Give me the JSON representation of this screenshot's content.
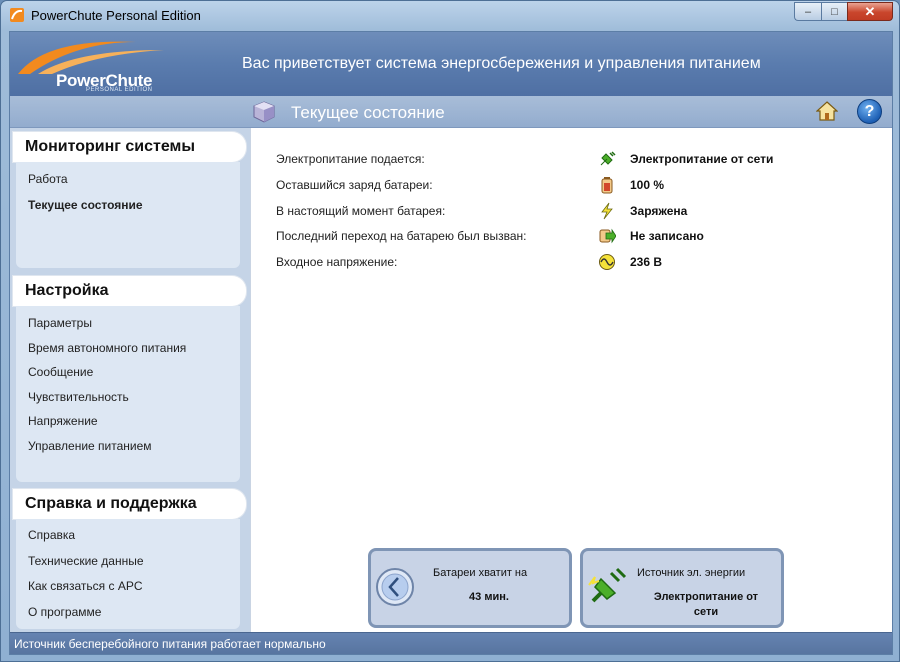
{
  "window": {
    "title": "PowerChute Personal Edition",
    "controls": {
      "minimize": "‒",
      "maximize": "□",
      "close": "✕"
    }
  },
  "banner": {
    "logo_text": "PowerChute",
    "logo_subtext": "PERSONAL EDITION",
    "welcome": "Вас приветствует система энергосбережения и управления питанием"
  },
  "header": {
    "title": "Текущее состояние",
    "icons": [
      "cube-icon",
      "home-icon",
      "help-icon"
    ],
    "help_glyph": "?"
  },
  "sidebar": {
    "groups": [
      {
        "title": "Мониторинг системы",
        "items": [
          "Работа",
          "Текущее состояние"
        ],
        "active": "Текущее состояние"
      },
      {
        "title": "Настройка",
        "items": [
          "Параметры",
          "Время автономного питания",
          "Сообщение",
          "Чувствительность",
          "Напряжение",
          "Управление питанием"
        ]
      },
      {
        "title": "Справка и поддержка",
        "items": [
          "Справка",
          "Технические данные",
          "Как связаться с APC",
          "О программе"
        ]
      }
    ]
  },
  "status": {
    "rows": [
      {
        "label": "Электропитание подается:",
        "value": "Электропитание от сети",
        "icon": "plug-icon"
      },
      {
        "label": "Оставшийся заряд батареи:",
        "value": "100 %",
        "icon": "battery-icon"
      },
      {
        "label": "В настоящий момент батарея:",
        "value": "Заряжена",
        "icon": "lightning-icon"
      },
      {
        "label": "Последний переход на батарею был вызван:",
        "value": "Не записано",
        "icon": "transfer-icon"
      },
      {
        "label": "Входное напряжение:",
        "value": "236 В",
        "icon": "voltage-icon"
      }
    ]
  },
  "cards": {
    "runtime": {
      "title": "Батареи хватит на",
      "value": "43 мин.",
      "icon": "clock-icon"
    },
    "source": {
      "title": "Источник эл. энергии",
      "value_line1": "Электропитание от",
      "value_line2": "сети",
      "icon": "plug-icon"
    }
  },
  "statusbar": {
    "text": "Источник бесперебойного питания работает нормально"
  },
  "colors": {
    "banner": "#5a7cae",
    "sidebar_panel": "#dde7f3",
    "card": "#c8d3e6",
    "statusbar": "#57749f"
  }
}
